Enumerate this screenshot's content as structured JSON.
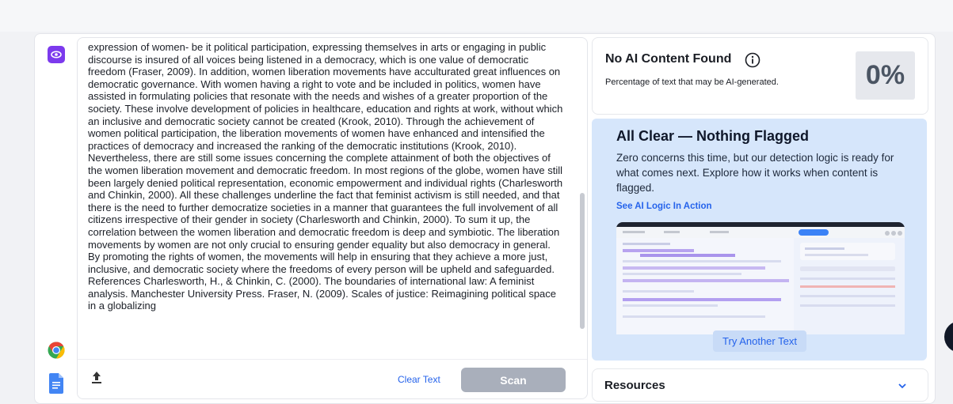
{
  "editor": {
    "text": "expression of women- be it political participation, expressing themselves in arts or engaging in public discourse is insured of all voices being listened in a democracy, which is one value of democratic freedom (Fraser, 2009). In addition, women liberation movements have acculturated great influences on democratic governance. With women having a right to vote and be included in politics, women have assisted in formulating policies that resonate with the needs and wishes of a greater proportion of the society. These involve development of policies in healthcare, education and rights at work, without which an inclusive and democratic society cannot be created (Krook, 2010). Through the achievement of women political participation, the liberation movements of women have enhanced and intensified the practices of democracy and increased the ranking of the democratic institutions (Krook, 2010). Nevertheless, there are still some issues concerning the complete attainment of both the objectives of the women liberation movement and democratic freedom. In most regions of the globe, women have still been largely denied political representation, economic empowerment and individual rights (Charlesworth and Chinkin, 2000). All these challenges underline the fact that feminist activism is still needed, and that there is the need to further democratize societies in a manner that guarantees the full involvement of all citizens irrespective of their gender in society (Charlesworth and Chinkin, 2000). To sum it up, the correlation between the women liberation and democratic freedom is deep and symbiotic. The liberation movements by women are not only crucial to ensuring gender equality but also democracy in general. By promoting the rights of women, the movements will help in ensuring that they achieve a more just, inclusive, and democratic society where the freedoms of every person will be upheld and safeguarded. References Charlesworth, H., & Chinkin, C. (2000). The boundaries of international law: A feminist analysis. Manchester University Press. Fraser, N. (2009). Scales of justice: Reimagining political space in a globalizing",
    "clear_label": "Clear Text",
    "scan_label": "Scan"
  },
  "result": {
    "title": "No AI Content Found",
    "subtitle": "Percentage of text that may be AI-generated.",
    "percent": "0%"
  },
  "clear_panel": {
    "title": "All Clear — Nothing Flagged",
    "description": "Zero concerns this time, but our detection logic is ready for what comes next. Explore how it works when content is flagged.",
    "link": "See AI Logic In Action",
    "try_label": "Try Another Text"
  },
  "resources": {
    "label": "Resources"
  },
  "colors": {
    "accent": "#7c3aed",
    "link": "#2563eb",
    "panel": "#d6e6fb",
    "scan_disabled": "#a9afbb"
  },
  "icons": [
    "eye-icon",
    "chrome-icon",
    "google-docs-icon",
    "upload-icon",
    "info-icon",
    "chevron-down-icon"
  ]
}
